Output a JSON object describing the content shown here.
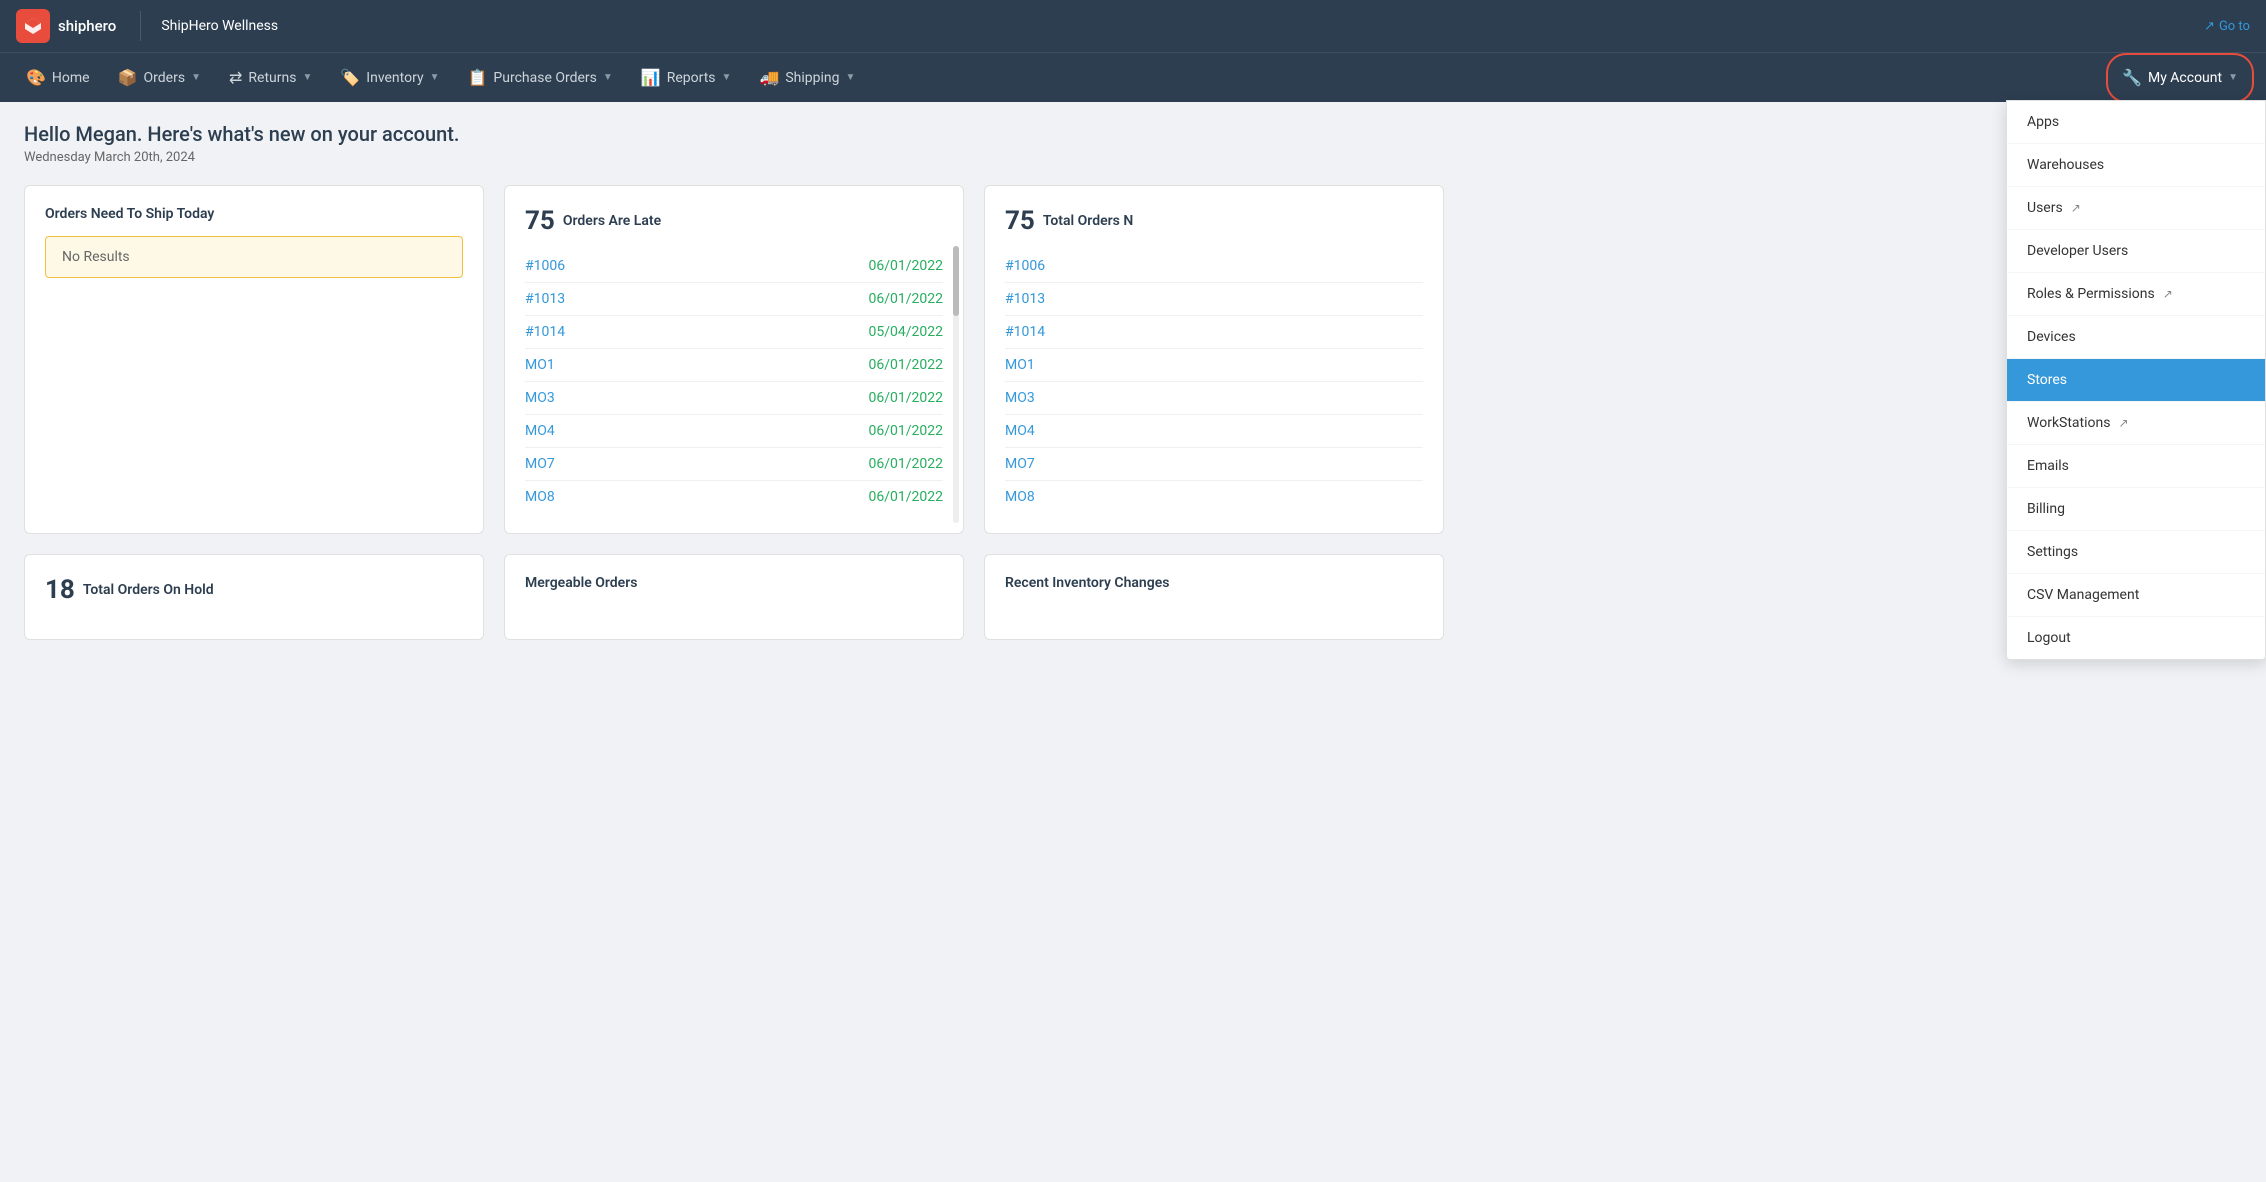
{
  "topbar": {
    "logo_text": "shiphero",
    "company_name": "ShipHero Wellness",
    "goto_label": "Go to"
  },
  "navbar": {
    "items": [
      {
        "id": "home",
        "label": "Home",
        "icon": "🎨",
        "has_dropdown": false
      },
      {
        "id": "orders",
        "label": "Orders",
        "icon": "📦",
        "has_dropdown": true
      },
      {
        "id": "returns",
        "label": "Returns",
        "icon": "🔄",
        "has_dropdown": true
      },
      {
        "id": "inventory",
        "label": "Inventory",
        "icon": "🏷️",
        "has_dropdown": true
      },
      {
        "id": "purchase-orders",
        "label": "Purchase Orders",
        "icon": "📋",
        "has_dropdown": true
      },
      {
        "id": "reports",
        "label": "Reports",
        "icon": "📊",
        "has_dropdown": true
      },
      {
        "id": "shipping",
        "label": "Shipping",
        "icon": "🚚",
        "has_dropdown": true
      },
      {
        "id": "my-account",
        "label": "My Account",
        "icon": "🔧",
        "has_dropdown": true,
        "circled": true
      }
    ]
  },
  "greeting": {
    "title": "Hello Megan. Here's what's new on your account.",
    "date": "Wednesday March 20th, 2024"
  },
  "cards": {
    "orders_need_to_ship": {
      "title": "Orders Need To Ship Today",
      "no_results": "No Results"
    },
    "orders_are_late": {
      "count": "75",
      "title": "Orders Are Late",
      "orders": [
        {
          "id": "#1006",
          "date": "06/01/2022"
        },
        {
          "id": "#1013",
          "date": "06/01/2022"
        },
        {
          "id": "#1014",
          "date": "05/04/2022"
        },
        {
          "id": "MO1",
          "date": "06/01/2022"
        },
        {
          "id": "MO3",
          "date": "06/01/2022"
        },
        {
          "id": "MO4",
          "date": "06/01/2022"
        },
        {
          "id": "MO7",
          "date": "06/01/2022"
        },
        {
          "id": "MO8",
          "date": "06/01/2022"
        }
      ]
    },
    "total_orders": {
      "count": "75",
      "title": "Total Orders N",
      "orders": [
        {
          "id": "#1006"
        },
        {
          "id": "#1013"
        },
        {
          "id": "#1014"
        },
        {
          "id": "MO1"
        },
        {
          "id": "MO3"
        },
        {
          "id": "MO4"
        },
        {
          "id": "MO7"
        },
        {
          "id": "MO8"
        }
      ]
    }
  },
  "bottom_cards": {
    "total_orders_hold": {
      "count": "18",
      "title": "Total Orders On Hold"
    },
    "mergeable_orders": {
      "title": "Mergeable Orders"
    },
    "recent_inventory": {
      "title": "Recent Inventory Changes"
    }
  },
  "dropdown": {
    "items": [
      {
        "id": "apps",
        "label": "Apps",
        "has_ext": false
      },
      {
        "id": "warehouses",
        "label": "Warehouses",
        "has_ext": false
      },
      {
        "id": "users",
        "label": "Users",
        "has_ext": true
      },
      {
        "id": "developer-users",
        "label": "Developer Users",
        "has_ext": false
      },
      {
        "id": "roles-permissions",
        "label": "Roles & Permissions",
        "has_ext": true
      },
      {
        "id": "devices",
        "label": "Devices",
        "has_ext": false
      },
      {
        "id": "stores",
        "label": "Stores",
        "has_ext": false,
        "active": true
      },
      {
        "id": "workstations",
        "label": "WorkStations",
        "has_ext": true
      },
      {
        "id": "emails",
        "label": "Emails",
        "has_ext": false
      },
      {
        "id": "billing",
        "label": "Billing",
        "has_ext": false
      },
      {
        "id": "settings",
        "label": "Settings",
        "has_ext": false
      },
      {
        "id": "csv-management",
        "label": "CSV Management",
        "has_ext": false
      },
      {
        "id": "logout",
        "label": "Logout",
        "has_ext": false
      }
    ]
  }
}
